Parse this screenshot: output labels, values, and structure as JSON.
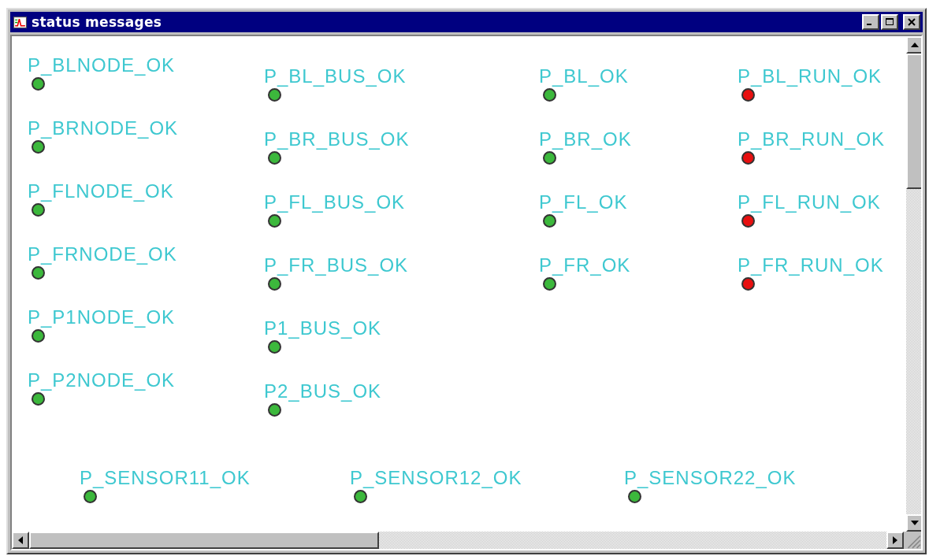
{
  "window": {
    "title": "status messages"
  },
  "status_rows": [
    [
      {
        "label": "P_BLNODE_OK",
        "color": "#3cb83c"
      },
      {
        "label": "P_BL_BUS_OK",
        "color": "#3cb83c"
      },
      {
        "label": "P_BL_OK",
        "color": "#3cb83c"
      },
      {
        "label": "P_BL_RUN_OK",
        "color": "#e81010"
      }
    ],
    [
      {
        "label": "P_BRNODE_OK",
        "color": "#3cb83c"
      },
      {
        "label": "P_BR_BUS_OK",
        "color": "#3cb83c"
      },
      {
        "label": "P_BR_OK",
        "color": "#3cb83c"
      },
      {
        "label": "P_BR_RUN_OK",
        "color": "#e81010"
      }
    ],
    [
      {
        "label": "P_FLNODE_OK",
        "color": "#3cb83c"
      },
      {
        "label": "P_FL_BUS_OK",
        "color": "#3cb83c"
      },
      {
        "label": "P_FL_OK",
        "color": "#3cb83c"
      },
      {
        "label": "P_FL_RUN_OK",
        "color": "#e81010"
      }
    ],
    [
      {
        "label": "P_FRNODE_OK",
        "color": "#3cb83c"
      },
      {
        "label": "P_FR_BUS_OK",
        "color": "#3cb83c"
      },
      {
        "label": "P_FR_OK",
        "color": "#3cb83c"
      },
      {
        "label": "P_FR_RUN_OK",
        "color": "#e81010"
      }
    ],
    [
      {
        "label": "P_P1NODE_OK",
        "color": "#3cb83c"
      },
      {
        "label": "P1_BUS_OK",
        "color": "#3cb83c"
      }
    ],
    [
      {
        "label": "P_P2NODE_OK",
        "color": "#3cb83c"
      },
      {
        "label": "P2_BUS_OK",
        "color": "#3cb83c"
      }
    ]
  ],
  "sensor_row": [
    {
      "label": "P_SENSOR11_OK",
      "color": "#3cb83c"
    },
    {
      "label": "P_SENSOR12_OK",
      "color": "#3cb83c"
    },
    {
      "label": "P_SENSOR22_OK",
      "color": "#3cb83c"
    }
  ]
}
